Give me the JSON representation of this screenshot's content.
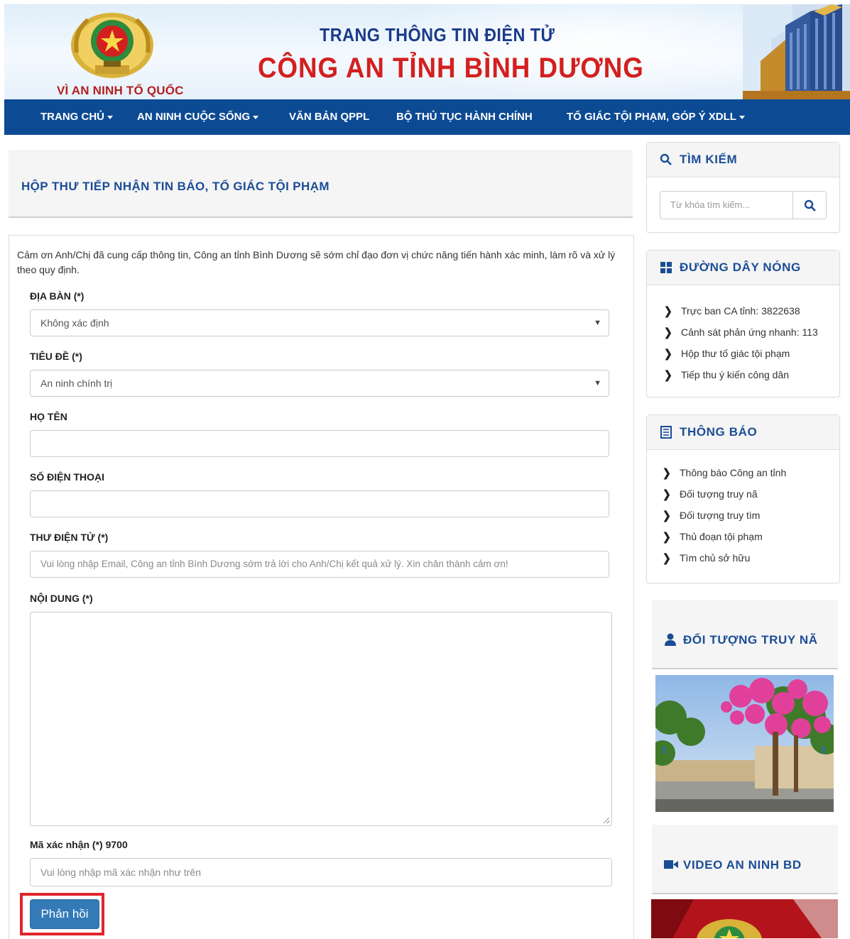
{
  "header": {
    "motto": "VÌ AN NINH TỔ QUỐC",
    "subtitle": "TRANG THÔNG TIN ĐIỆN TỬ",
    "title": "CÔNG AN TỈNH BÌNH DƯƠNG"
  },
  "nav": {
    "items": [
      {
        "label": "TRANG CHỦ",
        "dropdown": true
      },
      {
        "label": "AN NINH CUỘC SỐNG",
        "dropdown": true
      },
      {
        "label": "VĂN BẢN QPPL",
        "dropdown": false
      },
      {
        "label": "BỘ THỦ TỤC HÀNH CHÍNH",
        "dropdown": false
      },
      {
        "label": "TỐ GIÁC TỘI PHẠM, GÓP Ý XDLL",
        "dropdown": true
      }
    ]
  },
  "main": {
    "heading": "HỘP THƯ TIẾP NHẬN TIN BÁO, TỐ GIÁC TỘI PHẠM",
    "intro": "Cảm ơn Anh/Chị đã cung cấp thông tin, Công an tỉnh Bình Dương sẽ sớm chỉ đạo đơn vị chức năng tiến hành xác minh, làm rõ và xử lý theo quy định.",
    "form": {
      "area_label": "ĐỊA BÀN (*)",
      "area_value": "Không xác định",
      "subject_label": "TIÊU ĐỀ (*)",
      "subject_value": "An ninh chính trị",
      "name_label": "HỌ TÊN",
      "name_value": "",
      "phone_label": "SỐ ĐIỆN THOẠI",
      "phone_value": "",
      "email_label": "THƯ ĐIỆN TỬ (*)",
      "email_placeholder": "Vui lòng nhập Email, Công an tỉnh Bình Dương sớm trả lời cho Anh/Chị kết quả xử lý. Xin chân thành cảm ơn!",
      "content_label": "NỘI DUNG (*)",
      "content_value": "",
      "captcha_label": "Mã xác nhận (*) 9700",
      "captcha_placeholder": "Vui lòng nhập mã xác nhận như trên",
      "submit_label": "Phản hồi"
    }
  },
  "sidebar": {
    "search": {
      "title": "TÌM KIẾM",
      "placeholder": "Từ khóa tìm kiếm..."
    },
    "hotline": {
      "title": "ĐƯỜNG DÂY NÓNG",
      "items": [
        "Trực ban CA tỉnh: 3822638",
        "Cảnh sát phản ứng nhanh: 113",
        "Hộp thư tố giác tội phạm",
        "Tiếp thu ý kiến công dân"
      ]
    },
    "notices": {
      "title": "THÔNG BÁO",
      "items": [
        "Thông báo Công an tỉnh",
        "Đối tượng truy nã",
        "Đối tượng truy tìm",
        "Thủ đoạn tội phạm",
        "Tìm chủ sở hữu"
      ]
    },
    "wanted": {
      "title": "ĐỐI TƯỢNG TRUY NÃ"
    },
    "video": {
      "title": "VIDEO AN NINH BD"
    }
  },
  "colors": {
    "nav_bg": "#0c4a93",
    "heading_blue": "#1b4d96",
    "title_red": "#d3201f",
    "button_blue": "#337ab7",
    "highlight_red": "#e0242b"
  }
}
